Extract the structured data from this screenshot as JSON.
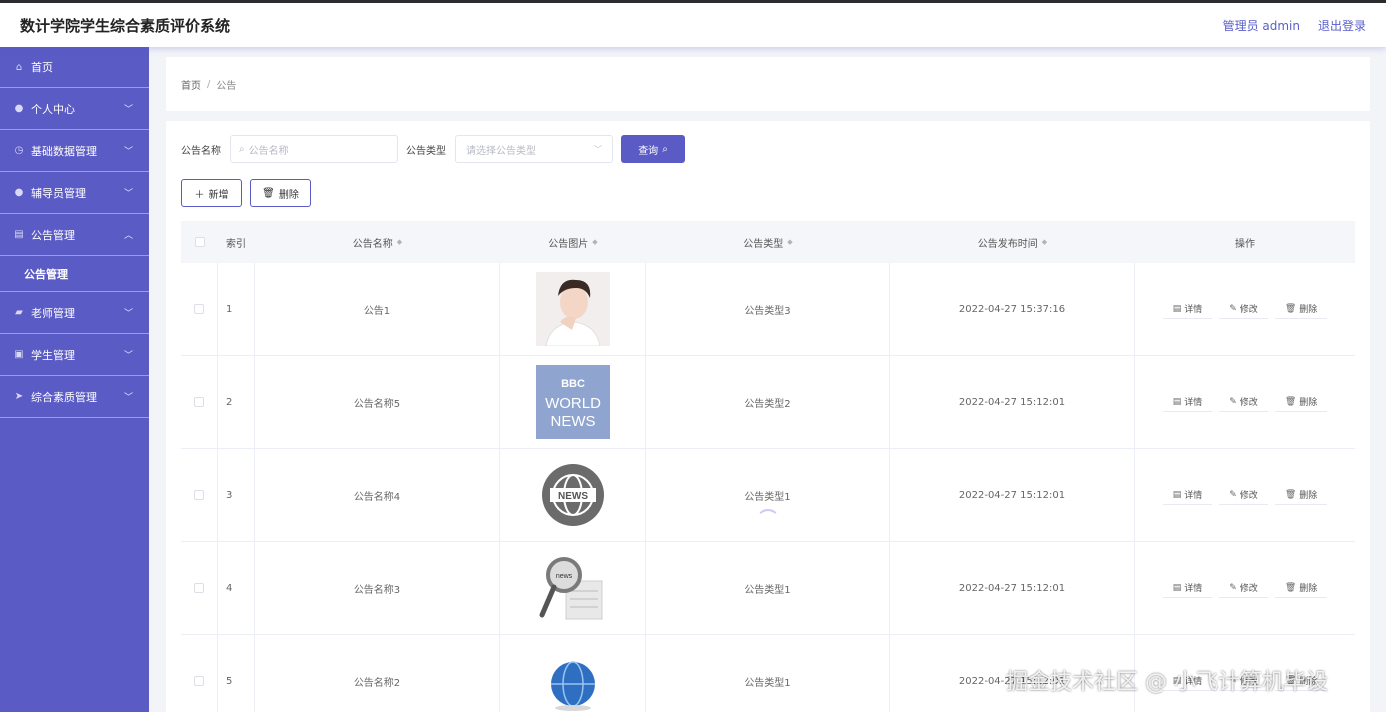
{
  "header": {
    "title": "数计学院学生综合素质评价系统",
    "user": "管理员 admin",
    "logout": "退出登录"
  },
  "sidebar": {
    "items": [
      {
        "label": "首页",
        "icon": "home-icon",
        "expandable": false
      },
      {
        "label": "个人中心",
        "icon": "user-icon",
        "expandable": true
      },
      {
        "label": "基础数据管理",
        "icon": "clock-icon",
        "expandable": true
      },
      {
        "label": "辅导员管理",
        "icon": "user-icon",
        "expandable": true
      },
      {
        "label": "公告管理",
        "icon": "document-icon",
        "expandable": true,
        "expanded": true,
        "sub": "公告管理"
      },
      {
        "label": "老师管理",
        "icon": "thumb-icon",
        "expandable": true
      },
      {
        "label": "学生管理",
        "icon": "briefcase-icon",
        "expandable": true
      },
      {
        "label": "综合素质管理",
        "icon": "send-icon",
        "expandable": true
      }
    ]
  },
  "breadcrumb": {
    "home": "首页",
    "sep": "/",
    "current": "公告"
  },
  "search": {
    "name_label": "公告名称",
    "name_placeholder": "公告名称",
    "type_label": "公告类型",
    "type_placeholder": "请选择公告类型",
    "query_button": "查询"
  },
  "actions": {
    "add": "新增",
    "delete": "删除"
  },
  "table": {
    "headers": {
      "index": "索引",
      "name": "公告名称",
      "image": "公告图片",
      "type": "公告类型",
      "time": "公告发布时间",
      "ops": "操作"
    },
    "op_labels": {
      "detail": "详情",
      "edit": "修改",
      "delete": "删除"
    },
    "rows": [
      {
        "index": "1",
        "name": "公告1",
        "type": "公告类型3",
        "time": "2022-04-27 15:37:16",
        "image": "portrait"
      },
      {
        "index": "2",
        "name": "公告名称5",
        "type": "公告类型2",
        "time": "2022-04-27 15:12:01",
        "image": "bbc-world-news"
      },
      {
        "index": "3",
        "name": "公告名称4",
        "type": "公告类型1",
        "time": "2022-04-27 15:12:01",
        "image": "news-globe-badge"
      },
      {
        "index": "4",
        "name": "公告名称3",
        "type": "公告类型1",
        "time": "2022-04-27 15:12:01",
        "image": "magnifier-news"
      },
      {
        "index": "5",
        "name": "公告名称2",
        "type": "公告类型1",
        "time": "2022-04-27 15:12:01",
        "image": "globe-news"
      }
    ]
  },
  "watermark": "掘金技术社区 @ 小飞计算机毕设",
  "colors": {
    "accent": "#5b5bc5",
    "header_bg": "#ffffff",
    "page_bg": "#f3f4f8"
  },
  "bbc_text": {
    "line1": "BBC",
    "line2": "WORLD",
    "line3": "NEWS"
  },
  "news_badge": "NEWS",
  "news_magnifier": "news"
}
